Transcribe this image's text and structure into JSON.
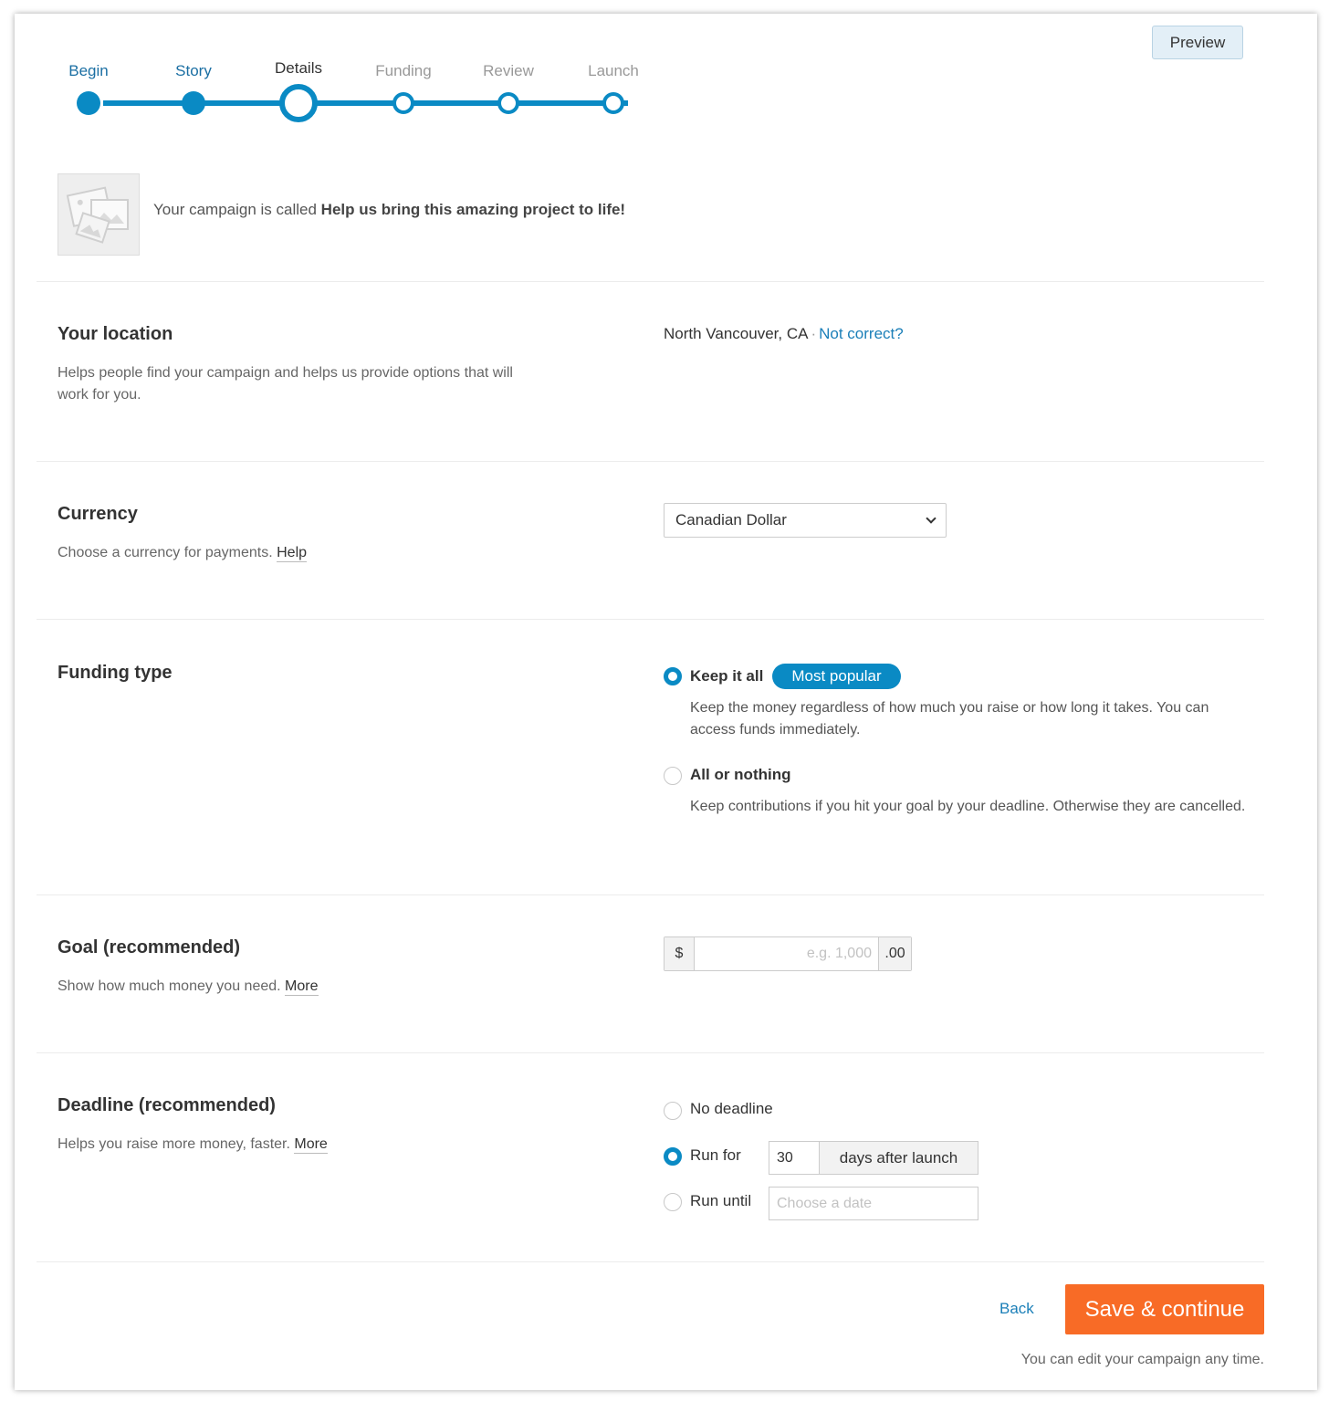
{
  "stepper": {
    "steps": [
      {
        "label": "Begin",
        "state": "done"
      },
      {
        "label": "Story",
        "state": "done"
      },
      {
        "label": "Details",
        "state": "current"
      },
      {
        "label": "Funding",
        "state": "todo"
      },
      {
        "label": "Review",
        "state": "todo"
      },
      {
        "label": "Launch",
        "state": "todo"
      }
    ]
  },
  "header": {
    "preview_label": "Preview",
    "campaign_prefix": "Your campaign is called",
    "campaign_name": "Help us bring this amazing project to life!",
    "thumbnail_icon": "image-placeholder-icon"
  },
  "location": {
    "title": "Your location",
    "description": "Helps people find your campaign and helps us provide options that will work for you.",
    "value": "North Vancouver, CA",
    "separator": "·",
    "change_link": "Not correct?"
  },
  "currency": {
    "title": "Currency",
    "description": "Choose a currency for payments.",
    "help_link": "Help",
    "selected": "Canadian Dollar"
  },
  "funding": {
    "title": "Funding type",
    "options": [
      {
        "label": "Keep it all",
        "badge": "Most popular",
        "description": "Keep the money regardless of how much you raise or how long it takes. You can access funds immediately.",
        "selected": true
      },
      {
        "label": "All or nothing",
        "description": "Keep contributions if you hit your goal by your deadline. Otherwise they are cancelled.",
        "selected": false
      }
    ]
  },
  "goal": {
    "title": "Goal (recommended)",
    "description": "Show how much money you need.",
    "more_link": "More",
    "prefix": "$",
    "placeholder": "e.g. 1,000",
    "suffix": ".00"
  },
  "deadline": {
    "title": "Deadline (recommended)",
    "description": "Helps you raise more money, faster.",
    "more_link": "More",
    "options": [
      {
        "label": "No deadline",
        "selected": false
      },
      {
        "label": "Run for",
        "selected": true
      },
      {
        "label": "Run until",
        "selected": false
      }
    ],
    "days_value": "30",
    "days_suffix": "days after launch",
    "date_placeholder": "Choose a date"
  },
  "footer": {
    "back_label": "Back",
    "save_label": "Save & continue",
    "note": "You can edit your campaign any time."
  },
  "colors": {
    "accent": "#0a8ac4",
    "save_button": "#f86b26",
    "link": "#1b7fb8"
  }
}
